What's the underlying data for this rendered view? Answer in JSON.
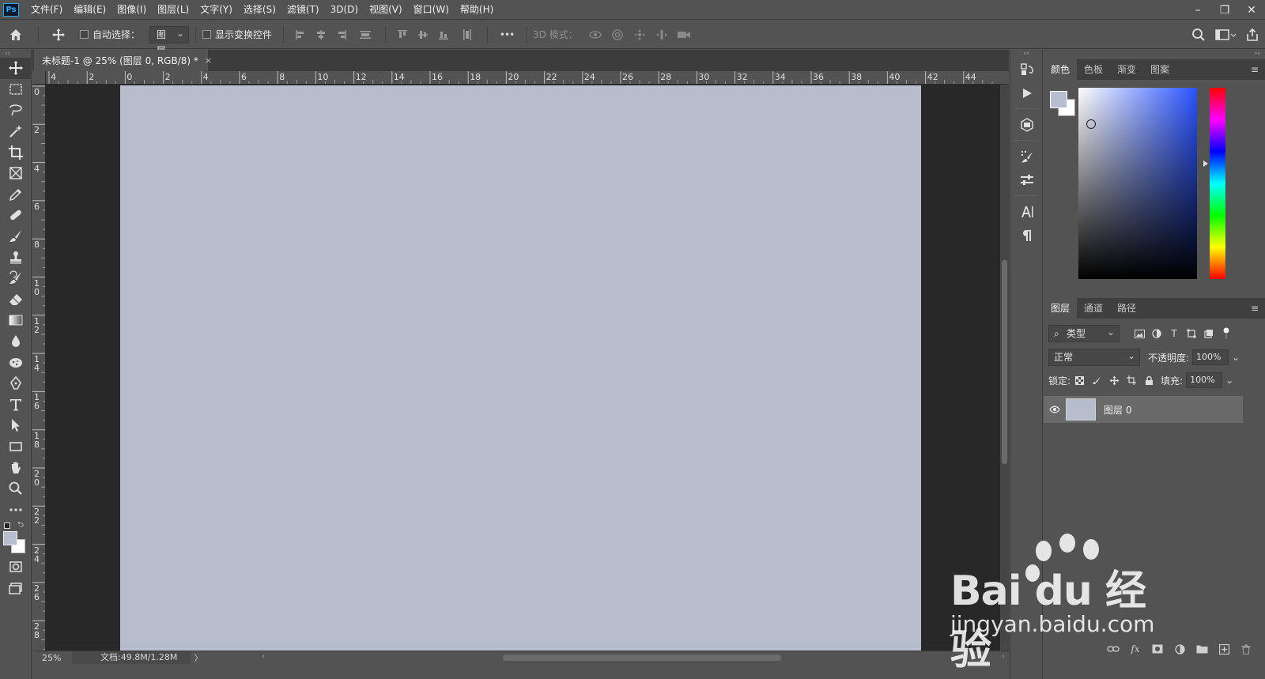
{
  "app": {
    "logo_text": "Ps"
  },
  "menu": [
    "文件(F)",
    "编辑(E)",
    "图像(I)",
    "图层(L)",
    "文字(Y)",
    "选择(S)",
    "滤镜(T)",
    "3D(D)",
    "视图(V)",
    "窗口(W)",
    "帮助(H)"
  ],
  "window_controls": {
    "minimize": "–",
    "restore": "❐",
    "close": "✕"
  },
  "options": {
    "auto_select_label": "自动选择：",
    "auto_select_value": "图层",
    "show_transform_label": "显示变换控件",
    "more": "•••",
    "mode_3d_label": "3D 模式："
  },
  "tools": [
    "move-tool",
    "marquee-tool",
    "lasso-tool",
    "magic-wand-tool",
    "crop-tool",
    "frame-tool",
    "eyedropper-tool",
    "healing-brush-tool",
    "brush-tool",
    "clone-stamp-tool",
    "history-brush-tool",
    "eraser-tool",
    "gradient-tool",
    "blur-tool",
    "dodge-tool",
    "pen-tool",
    "type-tool",
    "path-selection-tool",
    "rectangle-tool",
    "hand-tool",
    "zoom-tool",
    "edit-toolbar"
  ],
  "document": {
    "tab_title": "未标题-1 @ 25% (图层 0, RGB/8) *",
    "close": "×",
    "canvas_color": "#b8bdce",
    "zoom": "25%",
    "doc_info": "文档:49.8M/1.28M",
    "status_arrow": "〉"
  },
  "rulers": {
    "horizontal": [
      "4",
      "2",
      "0",
      "2",
      "4",
      "6",
      "8",
      "10",
      "12",
      "14",
      "16",
      "18",
      "20",
      "22",
      "24",
      "26",
      "28",
      "30",
      "32",
      "34",
      "36",
      "38",
      "40",
      "42",
      "44"
    ],
    "vertical": [
      "0",
      "2",
      "4",
      "6",
      "8",
      "10",
      "12",
      "14",
      "16",
      "18",
      "20",
      "22",
      "24",
      "26",
      "28"
    ]
  },
  "color_panel": {
    "tabs": [
      "颜色",
      "色板",
      "渐变",
      "图案"
    ],
    "active_tab": "颜色",
    "foreground": "#b8bdcf",
    "background": "#ffffff"
  },
  "layers_panel": {
    "tabs": [
      "图层",
      "通道",
      "路径"
    ],
    "active_tab": "图层",
    "filter_label": "类型",
    "blend_mode": "正常",
    "opacity_label": "不透明度:",
    "opacity_value": "100%",
    "lock_label": "锁定:",
    "fill_label": "填充:",
    "fill_value": "100%",
    "layers": [
      {
        "name": "图层 0",
        "visible": true
      }
    ]
  },
  "watermark": {
    "brand": "Bai du 经验",
    "url": "jingyan.baidu.com"
  },
  "colors": {
    "ui_bg": "#535353",
    "pasteboard": "#282828",
    "accent": "#31a8ff"
  }
}
